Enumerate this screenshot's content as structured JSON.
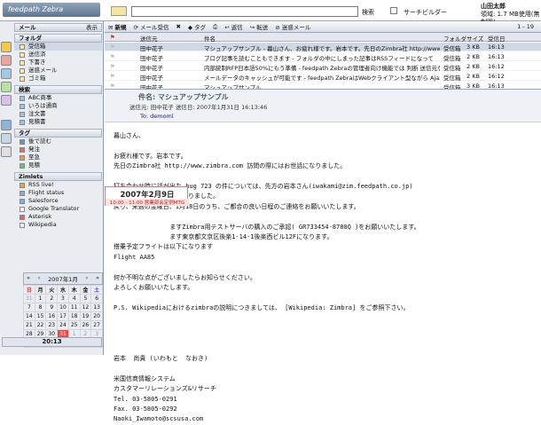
{
  "header": {
    "logo": "feedpath Zebra",
    "search_label": "検索",
    "search_builder": "サーチビルダー",
    "user_name": "山田太郎",
    "quota": "領域: 1.7 MB使用(無制限)"
  },
  "sidebar": {
    "mail_head": "メール",
    "view_label": "表示",
    "folder_head": "フォルダ",
    "folders": [
      "受信箱",
      "送信済",
      "下書き",
      "迷惑メール",
      "ゴミ箱"
    ],
    "search_head": "検索",
    "searches": [
      "ABC商事",
      "いろは通商",
      "注文書",
      "見積書"
    ],
    "tag_head": "タグ",
    "tags": [
      "後で読む",
      "発注",
      "至急",
      "見積"
    ],
    "zimlet_head": "Zimlets",
    "zimlets": [
      "RSS live!",
      "Flight status",
      "Salesforce",
      "Google Translator",
      "Asterisk",
      "Wikipedia"
    ],
    "calendar": {
      "title": "2007年1月",
      "days": [
        "日",
        "月",
        "火",
        "水",
        "木",
        "金",
        "土"
      ],
      "weeks": [
        [
          "31",
          "1",
          "2",
          "3",
          "4",
          "5",
          "6"
        ],
        [
          "7",
          "8",
          "9",
          "10",
          "11",
          "12",
          "13"
        ],
        [
          "14",
          "15",
          "16",
          "17",
          "18",
          "19",
          "20"
        ],
        [
          "21",
          "22",
          "23",
          "24",
          "25",
          "26",
          "27"
        ],
        [
          "28",
          "29",
          "30",
          "31",
          "1",
          "2",
          "3"
        ],
        [
          "4",
          "5",
          "6",
          "7",
          "8",
          "9",
          "10"
        ]
      ]
    },
    "clock": "20:13"
  },
  "toolbar": {
    "new": "新規",
    "get_mail": "メール受信",
    "tag": "タグ",
    "reply": "返信",
    "forward": "転送",
    "junk": "迷惑メール",
    "pager": "1 - 19"
  },
  "list": {
    "headers": {
      "from": "送信元",
      "subject": "件名",
      "folder": "フォルダ",
      "size": "サイズ",
      "received": "受信日"
    },
    "rows": [
      {
        "from": "田中花子",
        "subject": "マシュアップサンプル - 暮山さん、お疲れ様です。岩本です。先日のZimbra社 http://www.zimbra.com 訪問の際には",
        "folder": "受信箱",
        "size": "3 KB",
        "time": "16:13"
      },
      {
        "from": "田中花子",
        "subject": "ブログ記事を読むこともできます - フォルダの中にしまった記事はRSSフィードになって",
        "folder": "受信箱",
        "size": "2 KB",
        "time": "16:13"
      },
      {
        "from": "田中花子",
        "subject": "内部統制RFP日本語50%にもう準備 - feedpath Zebraの管理者向け機能では 判断 送信元などの制",
        "folder": "受信箱",
        "size": "2 KB",
        "time": "16:12"
      },
      {
        "from": "田中花子",
        "subject": "メールデータのキャッシュが可能です - feedpath ZebraはWebクライアント型ながら Ajaxで動的な",
        "folder": "受信箱",
        "size": "2 KB",
        "time": "16:12"
      },
      {
        "from": "田中花子",
        "subject": "マシュアップサンプル",
        "folder": "受信箱",
        "size": "3 KB",
        "time": "16:13"
      }
    ]
  },
  "message": {
    "subject": "件名: マシュアップサンプル",
    "from_line": "送信元: 田中花子 送信日: 2007年1月31日 16:13:46",
    "to_line": "To: demoml",
    "body": "暮山さん、\n\nお疲れ様です。岩本です。\n先日のZimbra社 http://www.zimbra.com 訪問の際にはお世話になりました。\n\n打ち合わせ時に話が出た bug 723 の件については、先方の岩本さん(iwakami@zim.feedpath.co.jp)\nから打ち合わせの要望がありました。\n戻り、来週の金曜日、1月18日のうち、ご都合の良い日程のご連絡をお願いいたします。\n\n               ますZimbra用テストサーバの購入のご承認( GR733454-8780Q )をお願いいたします。\n               ます東京都文京区後楽1-14-1後楽西ビル12Fになります。\n搭乗予定フライトは以下になります\nFlight AA85\n\n何か不明な点がございましたらお知らせください。\nよろしくお願いいたします。\n\nP.S. Wikipediaにおけるzimbraの説明につきましては、 [Wikipedia: Zimbra] をご参照下さい。\n\n\n\n\n岩本  尚貴 (いわもと  なおき)\n\n米国信商情報システム\nカスタマーリレーションズ&リサーチ\nTel. 03-5805-0291\nFax. 03-5805-0292\nNaoki_Iwamoto@scsusa.com",
    "popup_date": "2007年2月9日",
    "popup_sub": "10:00 - 11:00 営業部会定例MTG"
  },
  "colors": {
    "accent": "#5f7690",
    "selected": "#cfd8e4"
  }
}
